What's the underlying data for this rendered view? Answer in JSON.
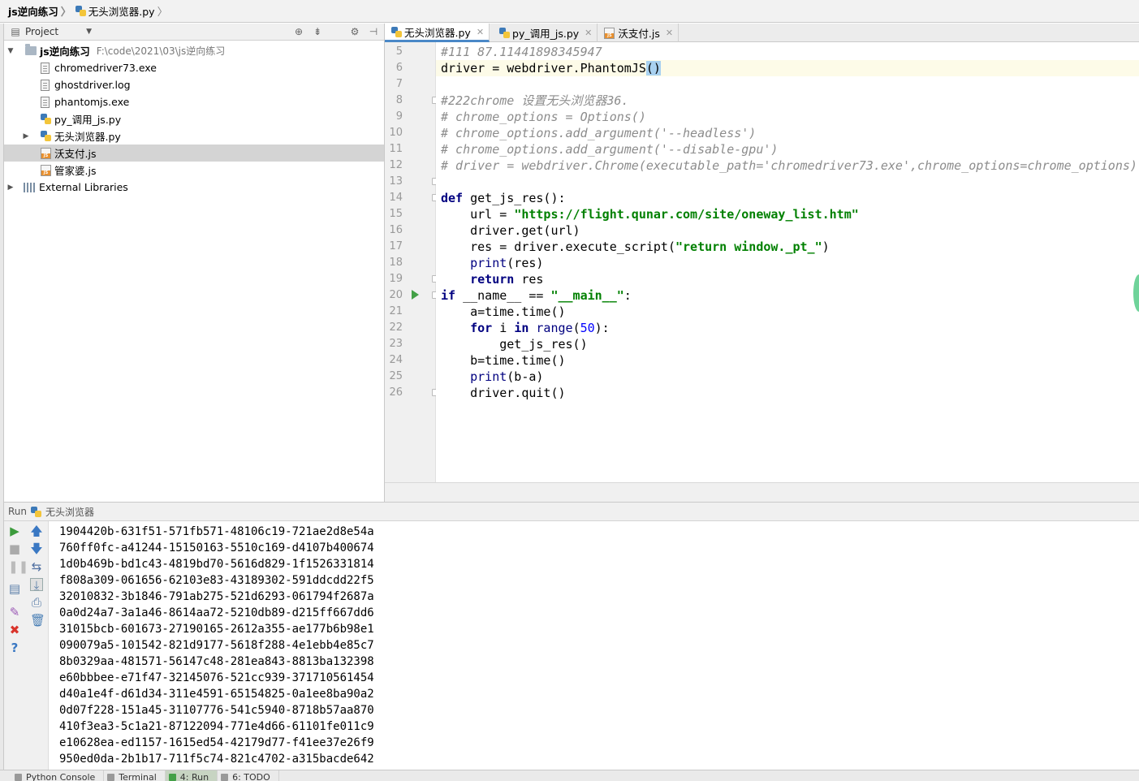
{
  "navbar": {
    "project_name": "js逆向练习",
    "file_name": "无头浏览器.py"
  },
  "project_panel": {
    "title": "Project",
    "root": {
      "name": "js逆向练习",
      "path": "F:\\code\\2021\\03\\js逆向练习"
    },
    "files": [
      {
        "name": "chromedriver73.exe",
        "icon": "file-icon"
      },
      {
        "name": "ghostdriver.log",
        "icon": "file-icon"
      },
      {
        "name": "phantomjs.exe",
        "icon": "file-icon"
      },
      {
        "name": "py_调用_js.py",
        "icon": "python-file-icon"
      },
      {
        "name": "无头浏览器.py",
        "icon": "python-file-icon"
      },
      {
        "name": "沃支付.js",
        "icon": "js-file-icon"
      },
      {
        "name": "管家婆.js",
        "icon": "js-file-icon"
      }
    ],
    "external": "External Libraries"
  },
  "editor": {
    "tabs": [
      {
        "label": "无头浏览器.py",
        "active": true
      },
      {
        "label": "py_调用_js.py",
        "active": false
      },
      {
        "label": "沃支付.js",
        "active": false
      }
    ],
    "line_numbers": [
      "5",
      "6",
      "7",
      "8",
      "9",
      "10",
      "11",
      "12",
      "13",
      "14",
      "15",
      "16",
      "17",
      "18",
      "19",
      "20",
      "21",
      "22",
      "23",
      "24",
      "25",
      "26"
    ],
    "code": {
      "l5": "#111 87.11441898345947",
      "l6a": "driver = webdriver.PhantomJS",
      "l6b": "()",
      "l8": "#222chrome 设置无头浏览器36.",
      "l9": "# chrome_options = Options()",
      "l10": "# chrome_options.add_argument('--headless')",
      "l11": "# chrome_options.add_argument('--disable-gpu')",
      "l12": "# driver = webdriver.Chrome(executable_path='chromedriver73.exe',chrome_options=chrome_options)",
      "l14_kw": "def",
      "l14": " get_js_res():",
      "l15a": "    url = ",
      "l15b": "\"https://flight.qunar.com/site/oneway_list.htm\"",
      "l16": "    driver.get(url)",
      "l17a": "    res = driver.execute_script(",
      "l17b": "\"return window._pt_\"",
      "l17c": ")",
      "l18a": "    ",
      "l18b": "print",
      "l18c": "(res)",
      "l19a": "    ",
      "l19b": "return",
      "l19c": " res",
      "l20a": "if",
      "l20b": " __name__ == ",
      "l20c": "\"__main__\"",
      "l20d": ":",
      "l21": "    a=time.time()",
      "l22a": "    ",
      "l22b": "for",
      "l22c": " i ",
      "l22d": "in",
      "l22e": " ",
      "l22f": "range",
      "l22g": "(",
      "l22h": "50",
      "l22i": "):",
      "l23": "        get_js_res()",
      "l24": "    b=time.time()",
      "l25a": "    ",
      "l25b": "print",
      "l25c": "(b-a)",
      "l26": "    driver.quit()"
    }
  },
  "run_panel": {
    "label": "Run",
    "config": "无头浏览器",
    "output": [
      "1904420b-631f51-571fb571-48106c19-721ae2d8e54a",
      "760ff0fc-a41244-15150163-5510c169-d4107b400674",
      "1d0b469b-bd1c43-4819bd70-5616d829-1f1526331814",
      "f808a309-061656-62103e83-43189302-591ddcdd22f5",
      "32010832-3b1846-791ab275-521d6293-061794f2687a",
      "0a0d24a7-3a1a46-8614aa72-5210db89-d215ff667dd6",
      "31015bcb-601673-27190165-2612a355-ae177b6b98e1",
      "090079a5-101542-821d9177-5618f288-4e1ebb4e85c7",
      "8b0329aa-481571-56147c48-281ea843-8813ba132398",
      "e60bbbee-e71f47-32145076-521cc939-371710561454",
      "d40a1e4f-d61d34-311e4591-65154825-0a1ee8ba90a2",
      "0d07f228-151a45-31107776-541c5940-8718b57aa870",
      "410f3ea3-5c1a21-87122094-771e4d66-61101fe011c9",
      "e10628ea-ed1157-1615ed54-42179d77-f41ee37e26f9",
      "950ed0da-2b1b17-711f5c74-821c4702-a315bacde642"
    ]
  },
  "bottom_tabs": [
    "Python Console",
    "Terminal",
    "4: Run",
    "6: TODO"
  ]
}
